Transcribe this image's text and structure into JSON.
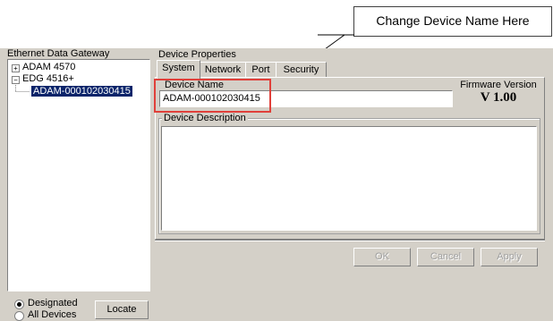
{
  "callout": {
    "text": "Change Device Name Here"
  },
  "left_panel": {
    "title": "Ethernet Data Gateway",
    "tree": [
      {
        "label": "ADAM 4570",
        "expander": "+"
      },
      {
        "label": "EDG 4516+",
        "expander": "−"
      },
      {
        "label": "ADAM-000102030415",
        "selected": true
      }
    ],
    "radios": [
      {
        "label": "Designated",
        "checked": true
      },
      {
        "label": "All Devices",
        "checked": false
      }
    ],
    "locate_label": "Locate"
  },
  "device_properties": {
    "title": "Device Properties",
    "tabs": [
      {
        "label": "System",
        "active": true
      },
      {
        "label": "Network",
        "active": false
      },
      {
        "label": "Port",
        "active": false
      },
      {
        "label": "Security",
        "active": false
      }
    ],
    "device_name": {
      "label": "Device Name",
      "value": "ADAM-000102030415"
    },
    "firmware": {
      "label": "Firmware Version",
      "value": "V 1.00"
    },
    "description": {
      "label": "Device Description",
      "value": ""
    }
  },
  "buttons": {
    "ok": "OK",
    "cancel": "Cancel",
    "apply": "Apply"
  },
  "colors": {
    "highlight_box": "#e0403a",
    "selection": "#0a246a",
    "face": "#d4d0c8"
  }
}
